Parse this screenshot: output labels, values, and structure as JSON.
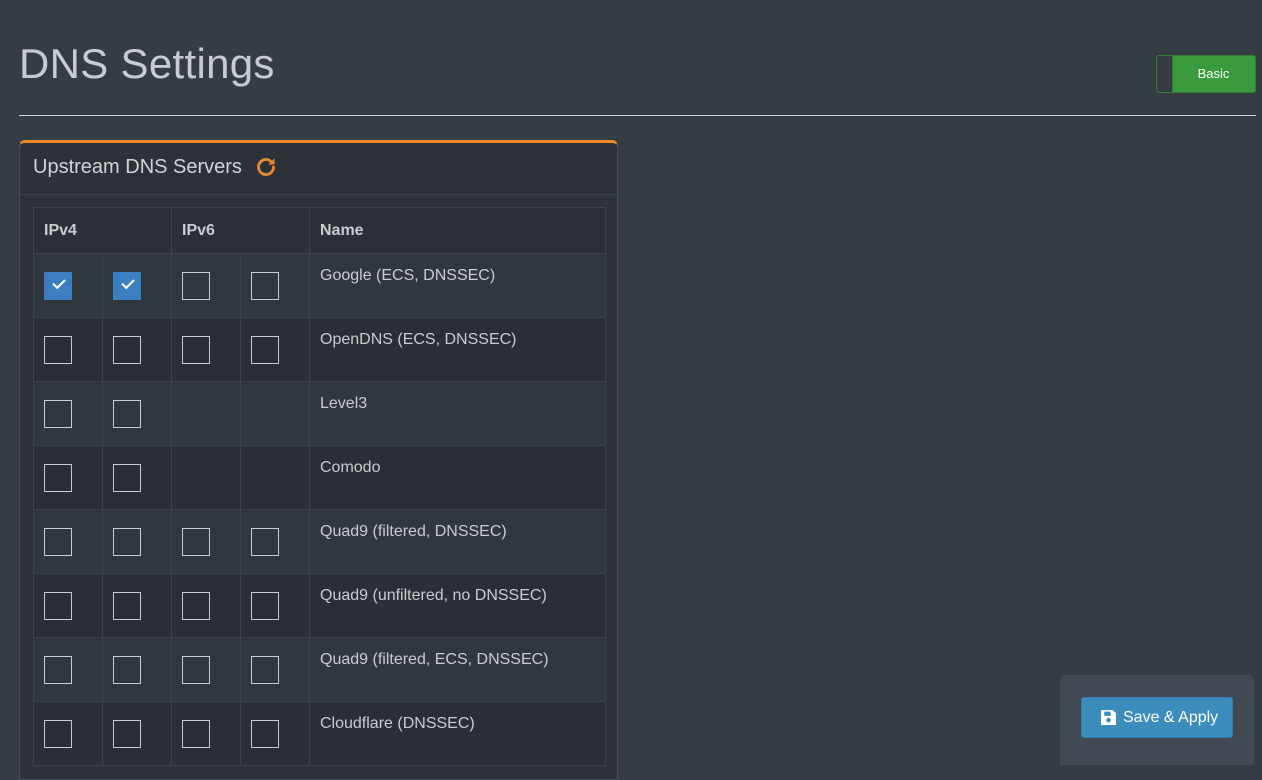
{
  "page": {
    "title": "DNS Settings",
    "mode_toggle_label": "Basic"
  },
  "upstream": {
    "title": "Upstream DNS Servers",
    "refresh_icon": "refresh-icon",
    "headers": {
      "ipv4": "IPv4",
      "ipv6": "IPv6",
      "name": "Name"
    },
    "rows": [
      {
        "name": "Google (ECS, DNSSEC)",
        "checks": [
          true,
          true,
          false,
          false
        ],
        "has_ipv6": true
      },
      {
        "name": "OpenDNS (ECS, DNSSEC)",
        "checks": [
          false,
          false,
          false,
          false
        ],
        "has_ipv6": true
      },
      {
        "name": "Level3",
        "checks": [
          false,
          false
        ],
        "has_ipv6": false
      },
      {
        "name": "Comodo",
        "checks": [
          false,
          false
        ],
        "has_ipv6": false
      },
      {
        "name": "Quad9 (filtered, DNSSEC)",
        "checks": [
          false,
          false,
          false,
          false
        ],
        "has_ipv6": true
      },
      {
        "name": "Quad9 (unfiltered, no DNSSEC)",
        "checks": [
          false,
          false,
          false,
          false
        ],
        "has_ipv6": true
      },
      {
        "name": "Quad9 (filtered, ECS, DNSSEC)",
        "checks": [
          false,
          false,
          false,
          false
        ],
        "has_ipv6": true
      },
      {
        "name": "Cloudflare (DNSSEC)",
        "checks": [
          false,
          false,
          false,
          false
        ],
        "has_ipv6": true
      }
    ]
  },
  "footer": {
    "save_label": "Save & Apply",
    "save_icon": "save-icon"
  },
  "colors": {
    "accent_orange": "#e8892b",
    "toggle_green": "#3a9b3e",
    "checkbox_blue": "#3c7fc0",
    "button_blue": "#3c8dbc"
  }
}
